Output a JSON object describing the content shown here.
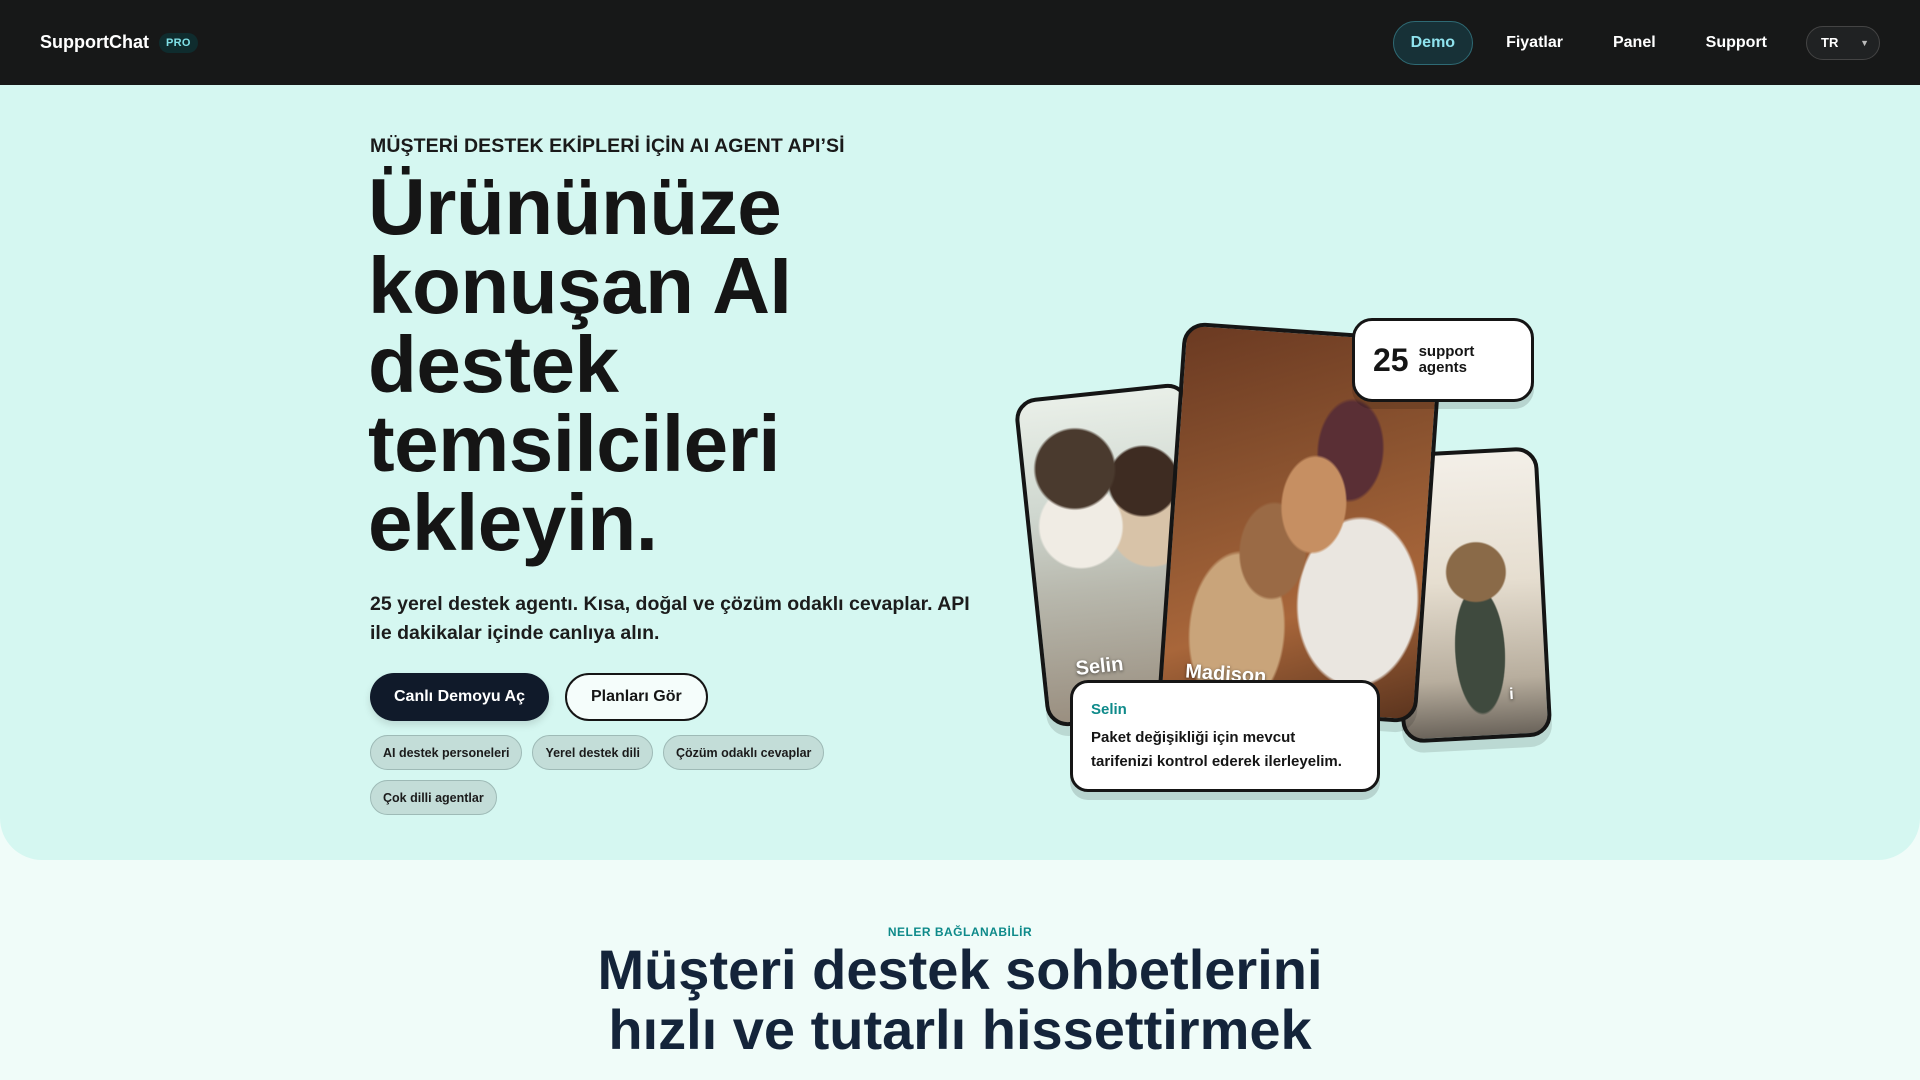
{
  "navbar": {
    "brand": "SupportChat",
    "badge": "PRO",
    "links": [
      "Demo",
      "Fiyatlar",
      "Panel",
      "Support"
    ],
    "active_link": "Demo",
    "language": "TR"
  },
  "hero": {
    "eyebrow": "MÜŞTERİ DESTEK EKİPLERİ İÇİN AI AGENT API’Sİ",
    "title": "Ürününüze konuşan AI destek temsilcileri ekleyin.",
    "subtitle": "25 yerel destek agentı. Kısa, doğal ve çözüm odaklı cevaplar. API ile dakikalar içinde canlıya alın.",
    "primary_button": "Canlı Demoyu Aç",
    "secondary_button": "Planları Gör",
    "chips": [
      "AI destek personeleri",
      "Yerel destek dili",
      "Çözüm odaklı cevaplar",
      "Çok dilli agentlar"
    ]
  },
  "art": {
    "stat_number": "25",
    "stat_label": "support agents",
    "cards": [
      {
        "name": "Selin"
      },
      {
        "name": "Madison"
      },
      {
        "name": "i"
      }
    ],
    "bubble": {
      "name": "Selin",
      "text": "Paket değişikliği için mevcut tarifenizi kontrol ederek ilerleyelim."
    }
  },
  "section": {
    "eyebrow": "NELER BAĞLANABİLİR",
    "title": "Müşteri destek sohbetlerini hızlı ve tutarlı hissettirmek"
  }
}
